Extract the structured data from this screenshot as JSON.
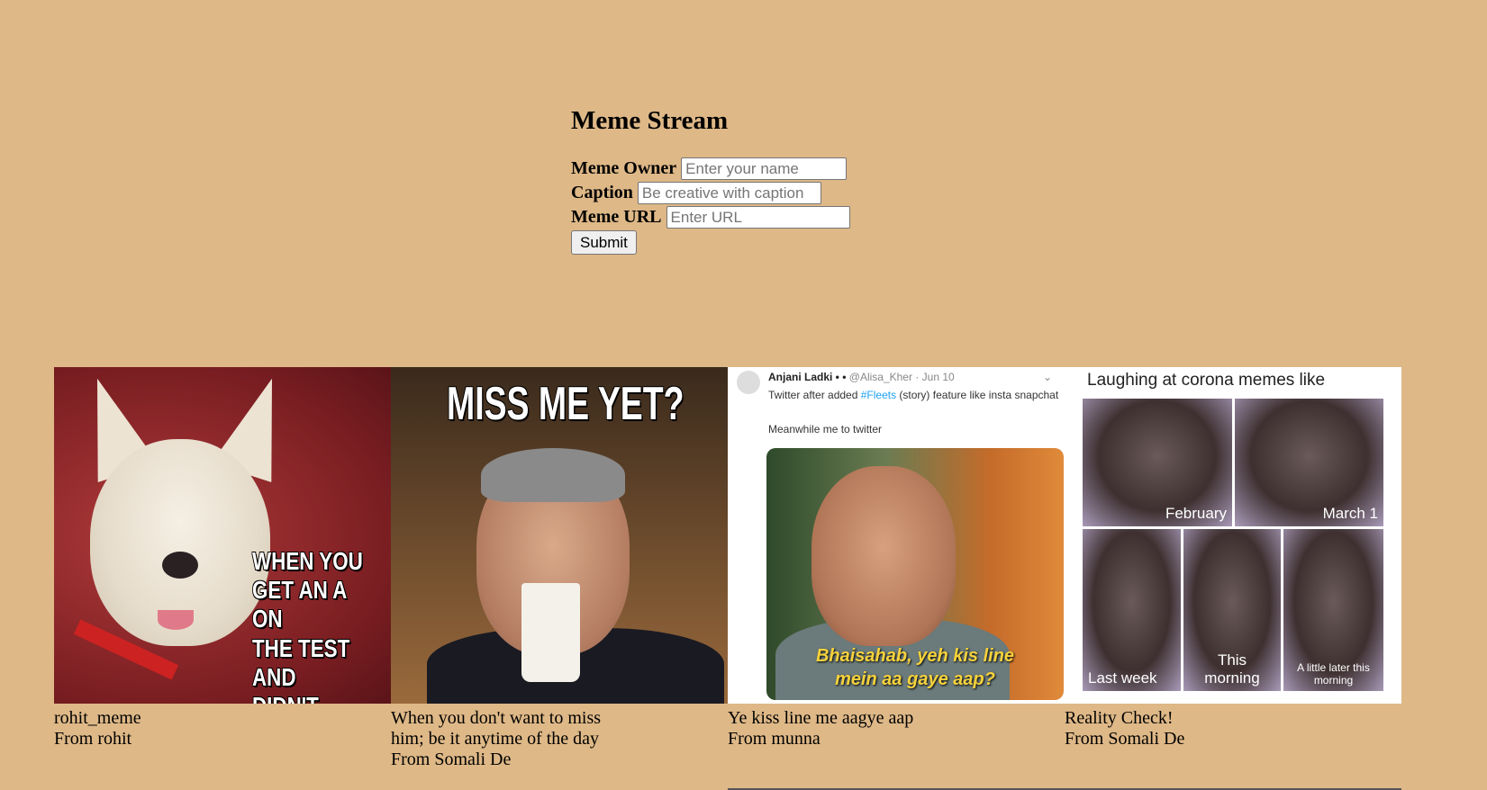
{
  "header": {
    "title": "Meme Stream"
  },
  "form": {
    "owner_label": "Meme Owner",
    "owner_placeholder": "Enter your name",
    "caption_label": "Caption",
    "caption_placeholder": "Be creative with caption",
    "url_label": "Meme URL",
    "url_placeholder": "Enter URL",
    "submit_label": "Submit"
  },
  "memes": [
    {
      "caption": "rohit_meme",
      "owner": "From rohit",
      "image_text": [
        "WHEN YOU",
        "GET AN A ON",
        "THE TEST AND",
        "DIDN'T STUDY."
      ]
    },
    {
      "caption": "When you don't want to miss him; be it anytime of the day",
      "owner": "From Somali De",
      "image_text": [
        "MISS ME YET?"
      ]
    },
    {
      "caption": "Ye kiss line me aagye aap",
      "owner": "From munna",
      "image_text": {
        "name": "Anjani Ladki • •",
        "handle": "@Alisa_Kher · Jun 10",
        "tweet_prefix": "Twitter after added ",
        "tweet_tag": "#Fleets",
        "tweet_suffix": " (story) feature like insta snapchat",
        "subtext": "Meanwhile me to twitter",
        "subtitle": "Bhaisahab, yeh kis line mein aa gaye aap?"
      }
    },
    {
      "caption": "Reality Check!",
      "owner": "From Somali De",
      "image_text": {
        "title": "Laughing at corona memes like",
        "tiles": [
          "February",
          "March 1",
          "Last week",
          "This morning",
          "A little later this morning"
        ]
      }
    }
  ]
}
